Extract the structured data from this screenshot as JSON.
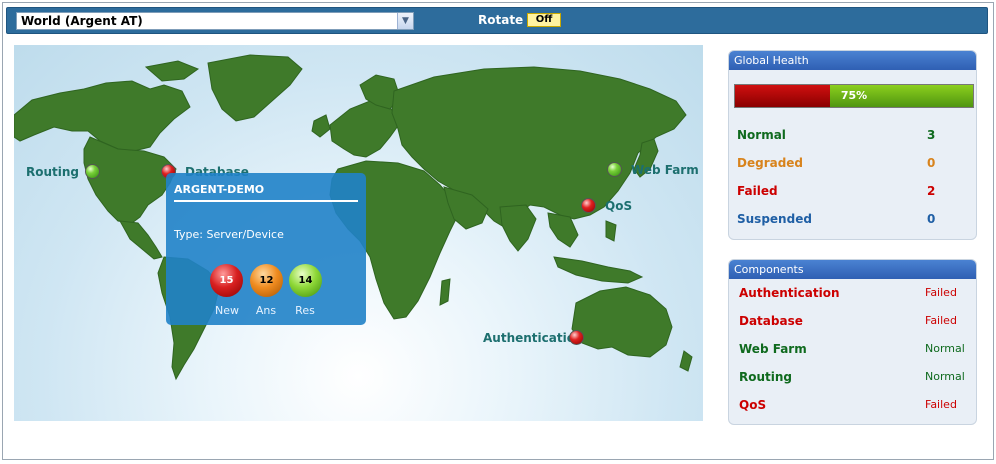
{
  "toolbar": {
    "view_select": "World (Argent AT)",
    "rotate_label": "Rotate",
    "rotate_value": "Off"
  },
  "map": {
    "markers": [
      {
        "label": "Routing",
        "status": "green"
      },
      {
        "label": "Database",
        "status": "red"
      },
      {
        "label": "Web Farm",
        "status": "green"
      },
      {
        "label": "QoS",
        "status": "red"
      },
      {
        "label": "Authentication",
        "status": "red"
      }
    ],
    "tooltip": {
      "title": "ARGENT-DEMO",
      "type": "Type:  Server/Device",
      "counts": [
        {
          "label": "New",
          "value": "15"
        },
        {
          "label": "Ans",
          "value": "12"
        },
        {
          "label": "Res",
          "value": "14"
        }
      ]
    }
  },
  "global_health": {
    "title": "Global Health",
    "percent_label": "75%",
    "percent": 75,
    "rows": [
      {
        "label": "Normal",
        "value": "3"
      },
      {
        "label": "Degraded",
        "value": "0"
      },
      {
        "label": "Failed",
        "value": "2"
      },
      {
        "label": "Suspended",
        "value": "0"
      }
    ]
  },
  "components": {
    "title": "Components",
    "rows": [
      {
        "name": "Authentication",
        "status": "Failed"
      },
      {
        "name": "Database",
        "status": "Failed"
      },
      {
        "name": "Web Farm",
        "status": "Normal"
      },
      {
        "name": "Routing",
        "status": "Normal"
      },
      {
        "name": "QoS",
        "status": "Failed"
      }
    ]
  },
  "colors": {
    "topbar": "#2d6c9c",
    "land": "#3f7a2a",
    "failed": "#cc0000",
    "normal": "#0f6a1e",
    "degraded": "#d8831c",
    "suspended": "#1f5fa5"
  }
}
